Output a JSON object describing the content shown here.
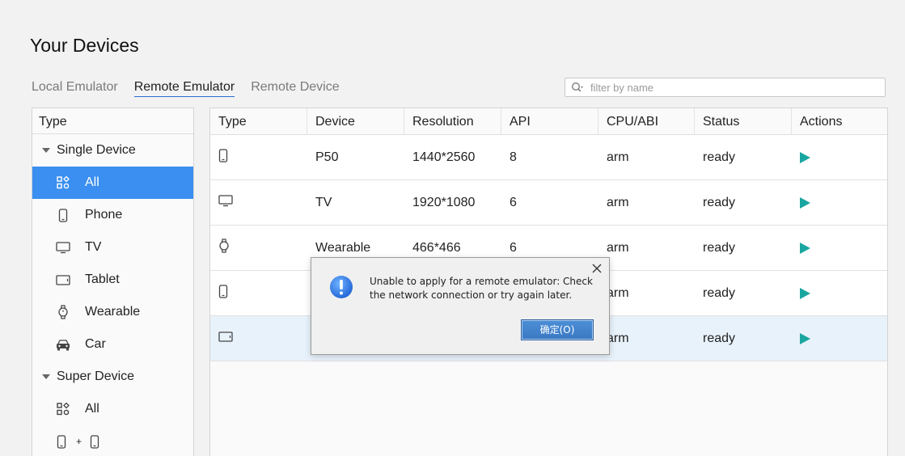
{
  "page": {
    "title": "Your Devices"
  },
  "tabs": [
    {
      "label": "Local Emulator",
      "active": false
    },
    {
      "label": "Remote Emulator",
      "active": true
    },
    {
      "label": "Remote Device",
      "active": false
    }
  ],
  "search": {
    "placeholder": "filter by name",
    "value": "",
    "icon": "search-icon"
  },
  "sidebar": {
    "header": "Type",
    "groups": [
      {
        "label": "Single Device",
        "items": [
          {
            "label": "All",
            "icon": "apps-icon",
            "selected": true
          },
          {
            "label": "Phone",
            "icon": "phone-icon"
          },
          {
            "label": "TV",
            "icon": "tv-icon"
          },
          {
            "label": "Tablet",
            "icon": "tablet-icon"
          },
          {
            "label": "Wearable",
            "icon": "watch-icon"
          },
          {
            "label": "Car",
            "icon": "car-icon"
          }
        ]
      },
      {
        "label": "Super Device",
        "items": [
          {
            "label": "All",
            "icon": "apps-icon"
          },
          {
            "label": "+",
            "icon": "phone-plus-phone-icon"
          }
        ]
      }
    ]
  },
  "table": {
    "columns": [
      "Type",
      "Device",
      "Resolution",
      "API",
      "CPU/ABI",
      "Status",
      "Actions"
    ],
    "rows": [
      {
        "type_icon": "phone-icon",
        "device": "P50",
        "resolution": "1440*2560",
        "api": "8",
        "cpu": "arm",
        "status": "ready",
        "action_icon": "play-icon"
      },
      {
        "type_icon": "tv-icon",
        "device": "TV",
        "resolution": "1920*1080",
        "api": "6",
        "cpu": "arm",
        "status": "ready",
        "action_icon": "play-icon"
      },
      {
        "type_icon": "watch-icon",
        "device": "Wearable",
        "resolution": "466*466",
        "api": "6",
        "cpu": "arm",
        "status": "ready",
        "action_icon": "play-icon"
      },
      {
        "type_icon": "phone-icon",
        "device": "",
        "resolution": "",
        "api": "",
        "cpu": "arm",
        "status": "ready",
        "action_icon": "play-icon"
      },
      {
        "type_icon": "tablet-icon",
        "device": "",
        "resolution": "",
        "api": "",
        "cpu": "arm",
        "status": "ready",
        "action_icon": "play-icon",
        "highlighted": true
      }
    ]
  },
  "dialog": {
    "message": "Unable to apply for a remote emulator: Check the network connection or try again later.",
    "ok_label": "确定(O)",
    "icon": "info-icon",
    "close_icon": "close-icon"
  },
  "colors": {
    "accent": "#3a8ff0",
    "play": "#1aa6a0",
    "highlight_row": "#e8f2fb",
    "dialog_button": "#3a78c3"
  }
}
